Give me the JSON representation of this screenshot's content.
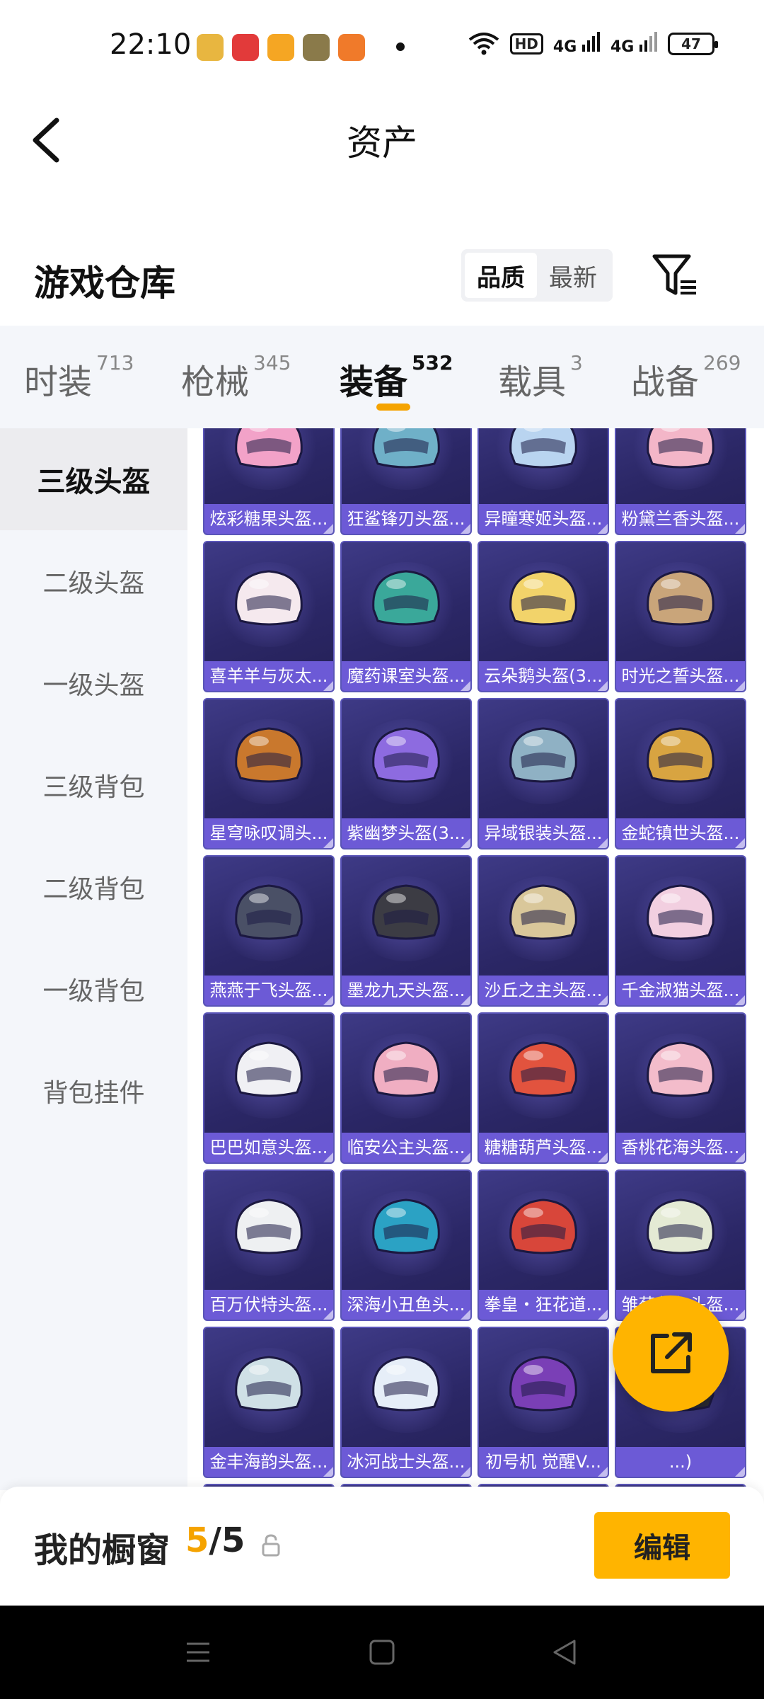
{
  "status_bar": {
    "time": "22:10",
    "app_icons": [
      "app-icon-1",
      "app-icon-2",
      "app-icon-3",
      "app-icon-4",
      "app-icon-5"
    ],
    "app_colors": [
      "#e8b640",
      "#e23a3a",
      "#f5a623",
      "#8a7a4a",
      "#f07a2a"
    ],
    "network_hd": "HD",
    "net1": "4G",
    "net2": "4G",
    "battery": "47"
  },
  "nav": {
    "title": "资产"
  },
  "warehouse": {
    "title": "游戏仓库",
    "sort_options": [
      "品质",
      "最新"
    ],
    "sort_selected": "品质"
  },
  "tabs": [
    {
      "label": "时装",
      "count": "713"
    },
    {
      "label": "枪械",
      "count": "345"
    },
    {
      "label": "装备",
      "count": "532",
      "active": true
    },
    {
      "label": "载具",
      "count": "3"
    },
    {
      "label": "战备",
      "count": "269"
    }
  ],
  "side_items": [
    "三级头盔",
    "二级头盔",
    "一级头盔",
    "三级背包",
    "二级背包",
    "一级背包",
    "背包挂件"
  ],
  "side_active": "三级头盔",
  "items": [
    {
      "name": "炫彩糖果头盔...",
      "color": "#f2a2c8"
    },
    {
      "name": "狂鲨锋刃头盔...",
      "color": "#6fb0c8"
    },
    {
      "name": "异瞳寒姬头盔...",
      "color": "#b9d4f0"
    },
    {
      "name": "粉黛兰香头盔...",
      "color": "#f3b6c8"
    },
    {
      "name": "喜羊羊与灰太...",
      "color": "#f5e9ee"
    },
    {
      "name": "魔药课室头盔...",
      "color": "#3aa89a"
    },
    {
      "name": "云朵鹅头盔(3...",
      "color": "#f2d36a"
    },
    {
      "name": "时光之誓头盔...",
      "color": "#c9a57a"
    },
    {
      "name": "星穹咏叹调头...",
      "color": "#c9782d"
    },
    {
      "name": "紫幽梦头盔(3...",
      "color": "#8d6be0"
    },
    {
      "name": "异域银装头盔...",
      "color": "#8fb1c4"
    },
    {
      "name": "金蛇镇世头盔...",
      "color": "#d8a441"
    },
    {
      "name": "燕燕于飞头盔...",
      "color": "#4a5066"
    },
    {
      "name": "墨龙九天头盔...",
      "color": "#3c3c44"
    },
    {
      "name": "沙丘之主头盔...",
      "color": "#d9c79a"
    },
    {
      "name": "千金淑猫头盔...",
      "color": "#f2cfe0"
    },
    {
      "name": "巴巴如意头盔...",
      "color": "#f0f0f4"
    },
    {
      "name": "临安公主头盔...",
      "color": "#f0aec2"
    },
    {
      "name": "糖糖葫芦头盔...",
      "color": "#e2533e"
    },
    {
      "name": "香桃花海头盔...",
      "color": "#f3bccb"
    },
    {
      "name": "百万伏特头盔...",
      "color": "#eef0f2"
    },
    {
      "name": "深海小丑鱼头...",
      "color": "#2ba2c4"
    },
    {
      "name": "拳皇・狂花道...",
      "color": "#d8463a"
    },
    {
      "name": "雏菊兔兔头盔...",
      "color": "#e4ead4"
    },
    {
      "name": "金丰海韵头盔...",
      "color": "#cfe0e6"
    },
    {
      "name": "冰河战士头盔...",
      "color": "#e6eef8"
    },
    {
      "name": "初号机 觉醒V...",
      "color": "#7a3fb6"
    },
    {
      "name": "...)",
      "color": "#2b2b33"
    },
    {
      "name": "",
      "color": "#e77fb0"
    },
    {
      "name": "",
      "color": "#a6d6f0"
    },
    {
      "name": "",
      "color": "#59b9e6"
    },
    {
      "name": "",
      "color": "#f08a8a"
    }
  ],
  "showcase": {
    "title": "我的橱窗",
    "used": "5",
    "separator": "/",
    "total": "5",
    "edit_label": "编辑"
  },
  "accent": "#ffb400"
}
